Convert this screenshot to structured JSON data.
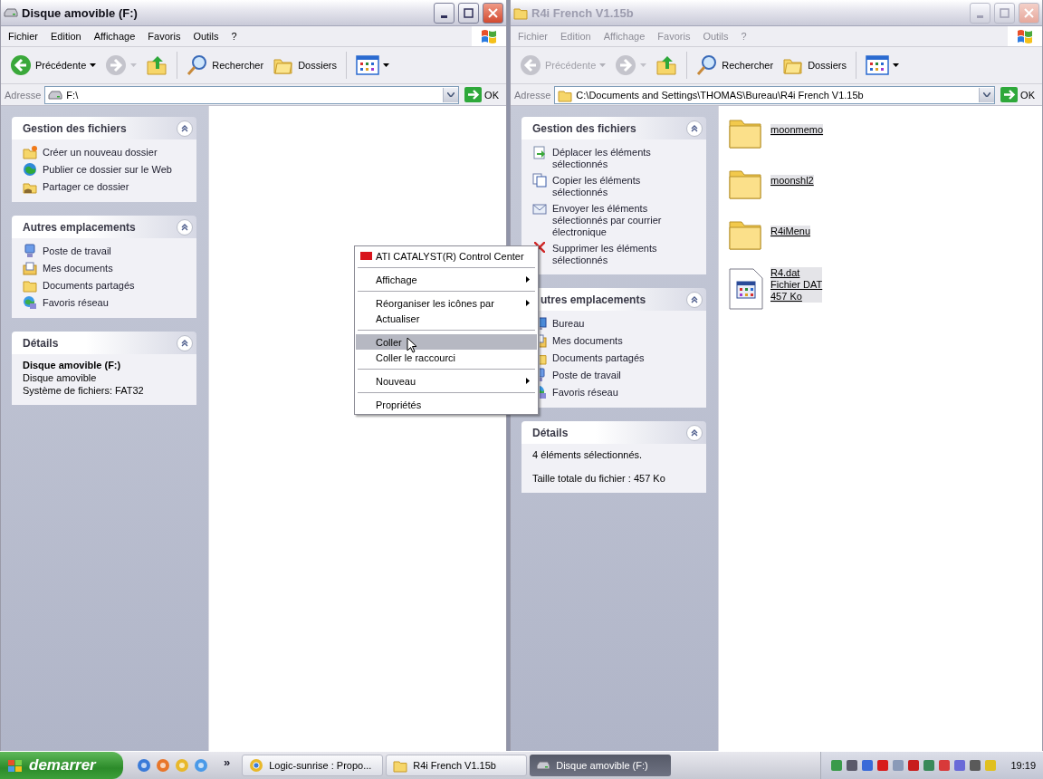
{
  "windows": [
    {
      "title": "Disque amovible (F:)",
      "active": true,
      "menu": [
        "Fichier",
        "Edition",
        "Affichage",
        "Favoris",
        "Outils",
        "?"
      ],
      "toolbar": {
        "back": {
          "label": "Précédente",
          "disabled": false
        },
        "forward": {
          "disabled": true
        },
        "search": "Rechercher",
        "folders": "Dossiers"
      },
      "address": {
        "label": "Adresse",
        "value": "F:\\",
        "go": "OK"
      },
      "panels": [
        {
          "kind": "tasks",
          "title": "Gestion des fichiers",
          "items": [
            {
              "label": "Créer un nouveau dossier"
            },
            {
              "label": "Publier ce dossier sur le Web"
            },
            {
              "label": "Partager ce dossier"
            }
          ]
        },
        {
          "kind": "tasks",
          "title": "Autres emplacements",
          "items": [
            {
              "label": "Poste de travail"
            },
            {
              "label": "Mes documents"
            },
            {
              "label": "Documents partagés"
            },
            {
              "label": "Favoris réseau"
            }
          ]
        },
        {
          "kind": "details",
          "title": "Détails",
          "lines": [
            {
              "text": "Disque amovible (F:)",
              "bold": true
            },
            {
              "text": "Disque amovible",
              "bold": false
            },
            {
              "text": "Système de fichiers: FAT32",
              "bold": false
            }
          ]
        }
      ]
    },
    {
      "title": "R4i French V1.15b",
      "active": false,
      "menu": [
        "Fichier",
        "Edition",
        "Affichage",
        "Favoris",
        "Outils",
        "?"
      ],
      "toolbar": {
        "back": {
          "label": "Précédente",
          "disabled": true
        },
        "forward": {
          "disabled": true
        },
        "search": "Rechercher",
        "folders": "Dossiers"
      },
      "address": {
        "label": "Adresse",
        "value": "C:\\Documents and Settings\\THOMAS\\Bureau\\R4i French V1.15b",
        "go": "OK"
      },
      "panels": [
        {
          "kind": "tasks",
          "title": "Gestion des fichiers",
          "items": [
            {
              "label": "Déplacer les éléments sélectionnés"
            },
            {
              "label": "Copier les éléments sélectionnés"
            },
            {
              "label": "Envoyer les éléments sélectionnés par courrier électronique"
            },
            {
              "label": "Supprimer les éléments sélectionnés"
            }
          ]
        },
        {
          "kind": "tasks",
          "title": "utres emplacements",
          "items": [
            {
              "label": "Bureau"
            },
            {
              "label": "Mes documents"
            },
            {
              "label": "Documents partagés"
            },
            {
              "label": "Poste de travail"
            },
            {
              "label": "Favoris réseau"
            }
          ]
        },
        {
          "kind": "details",
          "title": "Détails",
          "lines": [
            {
              "text": "4 éléments sélectionnés.",
              "bold": false
            },
            {
              "text": "Taille totale du fichier : 457 Ko",
              "bold": false
            }
          ]
        }
      ],
      "files": [
        {
          "kind": "folder",
          "lines": [
            "moonmemo"
          ],
          "selected": true
        },
        {
          "kind": "folder",
          "lines": [
            "moonshl2"
          ],
          "selected": true
        },
        {
          "kind": "folder",
          "lines": [
            "R4iMenu"
          ],
          "selected": true
        },
        {
          "kind": "file",
          "lines": [
            "R4.dat",
            "Fichier DAT",
            "457 Ko"
          ],
          "selected": true
        }
      ]
    }
  ],
  "context_menu": [
    {
      "kind": "command",
      "label": "ATI CATALYST(R) Control Center",
      "submenu": false,
      "highlighted": false
    },
    {
      "kind": "separator"
    },
    {
      "kind": "command",
      "label": "Affichage",
      "submenu": true,
      "highlighted": false
    },
    {
      "kind": "separator"
    },
    {
      "kind": "command",
      "label": "Réorganiser les icônes par",
      "submenu": true,
      "highlighted": false
    },
    {
      "kind": "command",
      "label": "Actualiser",
      "submenu": false,
      "highlighted": false
    },
    {
      "kind": "separator"
    },
    {
      "kind": "command",
      "label": "Coller",
      "submenu": false,
      "highlighted": true
    },
    {
      "kind": "command",
      "label": "Coller le raccourci",
      "submenu": false,
      "highlighted": false
    },
    {
      "kind": "separator"
    },
    {
      "kind": "command",
      "label": "Nouveau",
      "submenu": true,
      "highlighted": false
    },
    {
      "kind": "separator"
    },
    {
      "kind": "command",
      "label": "Propriétés",
      "submenu": false,
      "highlighted": false
    }
  ],
  "taskbar": {
    "start": "demarrer",
    "overflow": "»",
    "tasks": [
      {
        "label": "Logic-sunrise : Propo...",
        "selected": false
      },
      {
        "label": "R4i French V1.15b",
        "selected": false
      },
      {
        "label": "Disque amovible (F:)",
        "selected": true
      }
    ],
    "clock": "19:19"
  }
}
